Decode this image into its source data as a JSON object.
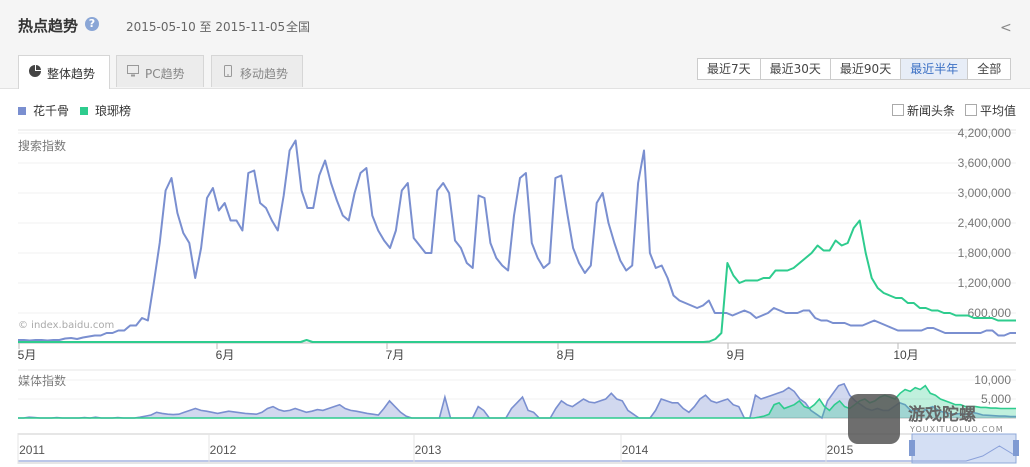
{
  "header": {
    "title": "热点趋势",
    "help_icon": "question-icon",
    "range": "2015-05-10 至 2015-11-05",
    "region": "全国",
    "share_icon": "share-icon"
  },
  "tabs": [
    {
      "label": "整体趋势",
      "icon": "pie-icon",
      "active": true
    },
    {
      "label": "PC趋势",
      "icon": "monitor-icon",
      "active": false
    },
    {
      "label": "移动趋势",
      "icon": "phone-icon",
      "active": false
    }
  ],
  "periods": [
    {
      "label": "最近7天",
      "selected": false
    },
    {
      "label": "最近30天",
      "selected": false
    },
    {
      "label": "最近90天",
      "selected": false
    },
    {
      "label": "最近半年",
      "selected": true
    },
    {
      "label": "全部",
      "selected": false
    }
  ],
  "options": {
    "news": "新闻头条",
    "average": "平均值"
  },
  "watermark": "© index.baidu.com",
  "brand": {
    "name": "游戏陀螺",
    "url": "YOUXITUOLUO.COM"
  },
  "chart_data": [
    {
      "type": "line",
      "ylabel": "搜索指数",
      "ylim": [
        0,
        4200000
      ],
      "yticks": [
        "600,000",
        "1,200,000",
        "1,800,000",
        "2,400,000",
        "3,000,000",
        "3,600,000",
        "4,200,000"
      ],
      "x_ticks": [
        "5月",
        "6月",
        "7月",
        "8月",
        "9月",
        "10月"
      ],
      "x_range": [
        "2015-05-10",
        "2015-11-05"
      ],
      "colors": {
        "花千骨": "#7a8fd0",
        "琅琊榜": "#2ecc8e"
      },
      "series": [
        {
          "name": "花千骨",
          "values": [
            60000,
            60000,
            50000,
            60000,
            60000,
            50000,
            60000,
            60000,
            90000,
            100000,
            80000,
            110000,
            130000,
            150000,
            150000,
            200000,
            200000,
            250000,
            250000,
            350000,
            350000,
            500000,
            450000,
            1200000,
            2000000,
            3050000,
            3300000,
            2600000,
            2200000,
            2000000,
            1300000,
            1900000,
            2900000,
            3100000,
            2650000,
            2800000,
            2450000,
            2450000,
            2250000,
            3400000,
            3450000,
            2800000,
            2700000,
            2450000,
            2250000,
            2950000,
            3850000,
            4050000,
            3050000,
            2700000,
            2700000,
            3350000,
            3650000,
            3200000,
            2850000,
            2550000,
            2450000,
            3000000,
            3400000,
            3500000,
            2550000,
            2250000,
            2050000,
            1900000,
            2250000,
            3050000,
            3200000,
            2100000,
            1950000,
            1800000,
            1800000,
            3050000,
            3200000,
            3000000,
            2050000,
            1900000,
            1600000,
            1500000,
            2950000,
            2900000,
            2000000,
            1700000,
            1550000,
            1450000,
            2550000,
            3300000,
            3400000,
            2000000,
            1700000,
            1500000,
            1600000,
            3300000,
            3350000,
            2600000,
            1900000,
            1600000,
            1400000,
            1550000,
            2800000,
            3000000,
            2400000,
            2000000,
            1650000,
            1450000,
            1550000,
            3200000,
            3850000,
            1800000,
            1500000,
            1550000,
            1300000,
            950000,
            850000,
            800000,
            750000,
            700000,
            750000,
            850000,
            600000,
            600000,
            600000,
            550000,
            600000,
            650000,
            600000,
            500000,
            550000,
            600000,
            700000,
            650000,
            600000,
            600000,
            600000,
            650000,
            650000,
            500000,
            450000,
            450000,
            400000,
            400000,
            400000,
            350000,
            350000,
            350000,
            400000,
            450000,
            400000,
            350000,
            300000,
            250000,
            250000,
            250000,
            250000,
            250000,
            300000,
            300000,
            250000,
            200000,
            200000,
            200000,
            200000,
            200000,
            200000,
            200000,
            250000,
            250000,
            150000,
            150000,
            200000,
            200000
          ]
        },
        {
          "name": "琅琊榜",
          "values": [
            20000,
            20000,
            20000,
            20000,
            20000,
            20000,
            20000,
            20000,
            20000,
            20000,
            20000,
            20000,
            20000,
            20000,
            20000,
            20000,
            20000,
            20000,
            20000,
            20000,
            20000,
            20000,
            20000,
            20000,
            20000,
            20000,
            20000,
            20000,
            20000,
            20000,
            20000,
            20000,
            20000,
            20000,
            20000,
            20000,
            20000,
            20000,
            20000,
            20000,
            20000,
            20000,
            20000,
            20000,
            20000,
            20000,
            20000,
            20000,
            60000,
            20000,
            20000,
            20000,
            20000,
            20000,
            20000,
            20000,
            20000,
            20000,
            20000,
            20000,
            20000,
            20000,
            20000,
            20000,
            20000,
            20000,
            20000,
            20000,
            20000,
            20000,
            20000,
            20000,
            20000,
            20000,
            20000,
            20000,
            20000,
            20000,
            20000,
            20000,
            20000,
            20000,
            20000,
            20000,
            20000,
            20000,
            20000,
            20000,
            20000,
            20000,
            20000,
            20000,
            20000,
            20000,
            20000,
            20000,
            20000,
            20000,
            20000,
            20000,
            20000,
            20000,
            20000,
            20000,
            20000,
            20000,
            20000,
            20000,
            20000,
            20000,
            20000,
            20000,
            20000,
            20000,
            20000,
            30000,
            80000,
            200000,
            1600000,
            1350000,
            1200000,
            1250000,
            1250000,
            1250000,
            1300000,
            1300000,
            1450000,
            1450000,
            1450000,
            1500000,
            1600000,
            1700000,
            1800000,
            1950000,
            1850000,
            1850000,
            2050000,
            1950000,
            2000000,
            2300000,
            2450000,
            1800000,
            1300000,
            1100000,
            1000000,
            950000,
            900000,
            900000,
            800000,
            800000,
            700000,
            700000,
            650000,
            650000,
            600000,
            600000,
            550000,
            550000,
            550000,
            500000,
            500000,
            500000,
            500000,
            450000,
            450000,
            450000,
            450000
          ]
        }
      ]
    },
    {
      "type": "area",
      "ylabel": "媒体指数",
      "ylim": [
        0,
        10000
      ],
      "yticks": [
        "5,000",
        "10,000"
      ],
      "series": [
        {
          "name": "花千骨",
          "values": [
            0,
            0,
            200,
            100,
            0,
            0,
            0,
            100,
            0,
            0,
            0,
            0,
            100,
            0,
            200,
            0,
            0,
            0,
            100,
            0,
            0,
            0,
            200,
            500,
            800,
            1500,
            1200,
            1000,
            900,
            1000,
            1500,
            2000,
            2500,
            2000,
            1800,
            1500,
            1200,
            1500,
            1800,
            1600,
            1400,
            1200,
            1100,
            1000,
            1500,
            2500,
            3000,
            2200,
            1800,
            2000,
            2500,
            2000,
            1500,
            1800,
            2200,
            2000,
            2500,
            3000,
            3500,
            2500,
            2000,
            1800,
            1500,
            1200,
            1000,
            800,
            2500,
            4500,
            3000,
            1500,
            500,
            0,
            0,
            0,
            0,
            0,
            0,
            5500,
            0,
            0,
            0,
            0,
            0,
            3000,
            2000,
            0,
            0,
            0,
            0,
            2500,
            4000,
            5500,
            2000,
            1500,
            0,
            0,
            0,
            2500,
            4500,
            3500,
            3000,
            4000,
            5000,
            4200,
            4000,
            4500,
            5000,
            6500,
            5000,
            4500,
            2000,
            1000,
            0,
            0,
            0,
            2000,
            5000,
            4500,
            4000,
            4000,
            2500,
            1500,
            3000,
            5000,
            6000,
            4500,
            4000,
            4500,
            5000,
            3500,
            3000,
            0,
            0,
            6000,
            5000,
            5500,
            6000,
            6500,
            7000,
            8000,
            7000,
            5000,
            4000,
            2000,
            1000,
            0,
            4500,
            6500,
            8500,
            9000,
            6000,
            4500,
            3500,
            2500,
            2000,
            2500,
            2000,
            2000,
            3000,
            4000,
            3500,
            2000,
            2000,
            1500,
            2500,
            3000,
            2000,
            1500,
            1200,
            1000,
            1200,
            1000,
            1500,
            1200,
            800,
            700,
            600,
            500,
            500,
            400,
            400
          ]
        },
        {
          "name": "琅琊榜",
          "values": [
            0,
            0,
            0,
            0,
            0,
            0,
            0,
            0,
            0,
            0,
            0,
            0,
            0,
            0,
            0,
            0,
            0,
            0,
            0,
            0,
            0,
            0,
            0,
            0,
            0,
            0,
            0,
            0,
            0,
            0,
            0,
            0,
            0,
            0,
            0,
            0,
            0,
            0,
            0,
            0,
            0,
            0,
            0,
            0,
            0,
            0,
            0,
            0,
            0,
            0,
            0,
            0,
            0,
            0,
            0,
            0,
            0,
            0,
            0,
            0,
            0,
            0,
            0,
            0,
            0,
            0,
            0,
            0,
            0,
            0,
            0,
            0,
            0,
            0,
            0,
            0,
            0,
            0,
            0,
            0,
            0,
            0,
            0,
            0,
            0,
            0,
            0,
            0,
            0,
            0,
            0,
            0,
            0,
            0,
            0,
            0,
            0,
            0,
            0,
            0,
            0,
            0,
            0,
            0,
            0,
            0,
            0,
            0,
            0,
            0,
            0,
            0,
            0,
            0,
            0,
            0,
            0,
            0,
            0,
            0,
            0,
            0,
            0,
            0,
            0,
            0,
            0,
            0,
            0,
            0,
            0,
            0,
            0,
            0,
            0,
            0,
            0,
            0,
            0,
            0,
            0,
            0,
            0,
            0,
            0,
            0,
            0,
            200,
            500,
            1000,
            3500,
            4000,
            2500,
            3000,
            3500,
            4500,
            3000,
            2500,
            3500,
            5000,
            3000,
            2000,
            3500,
            4500,
            3000,
            2500,
            3500,
            4500,
            5000,
            4000,
            4500,
            5500,
            6000,
            5500,
            5000,
            6500,
            7500,
            7000,
            8000,
            7500,
            8500,
            6500,
            6000,
            5000,
            4500,
            4000,
            3500,
            3500,
            3000,
            3000,
            3000,
            2800,
            2800,
            2600,
            2600,
            2500,
            2500,
            2500,
            2500
          ]
        }
      ]
    },
    {
      "type": "line",
      "xlabel": "",
      "x_ticks": [
        "2011",
        "2012",
        "2013",
        "2014",
        "2015"
      ],
      "series": [
        {
          "name": "花千骨",
          "values": [
            0,
            0,
            0,
            0,
            0,
            0,
            0,
            0,
            0,
            0,
            0,
            0,
            0,
            0,
            0,
            0,
            0,
            0,
            0,
            0,
            0,
            0,
            0,
            0,
            0,
            0,
            0,
            0,
            0,
            0,
            0,
            0,
            0,
            0,
            0,
            0,
            0,
            0,
            0,
            0,
            0,
            0,
            0,
            0,
            0,
            0,
            0,
            0,
            0,
            0,
            0,
            0,
            0,
            0,
            0,
            0,
            0,
            0,
            1,
            3,
            1
          ]
        }
      ]
    }
  ]
}
